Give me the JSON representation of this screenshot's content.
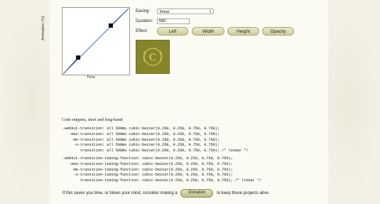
{
  "graph": {
    "y_label": "Animation (%)",
    "x_label": "Time"
  },
  "controls": {
    "easing_label": "Easing:",
    "easing_value": "linear",
    "duration_label": "Duration:",
    "duration_value": "500",
    "effect_label": "Effect:",
    "effects": [
      "Left",
      "Width",
      "Height",
      "Opacity"
    ]
  },
  "preview": {
    "letter": "C"
  },
  "snippets": {
    "title": "Code snippets, short and long-hand:",
    "short": [
      "-webkit-transition: all 500ms cubic-bezier(0.250, 0.250, 0.750, 0.750);",
      "   -moz-transition: all 500ms cubic-bezier(0.250, 0.250, 0.750, 0.750);",
      "    -ms-transition: all 500ms cubic-bezier(0.250, 0.250, 0.750, 0.750);",
      "     -o-transition: all 500ms cubic-bezier(0.250, 0.250, 0.750, 0.750);",
      "        transition: all 500ms cubic-bezier(0.250, 0.250, 0.750, 0.750); /* linear */"
    ],
    "long": [
      "-webkit-transition-timing-function: cubic-bezier(0.250, 0.250, 0.750, 0.750);",
      "   -moz-transition-timing-function: cubic-bezier(0.250, 0.250, 0.750, 0.750);",
      "    -ms-transition-timing-function: cubic-bezier(0.250, 0.250, 0.750, 0.750);",
      "     -o-transition-timing-function: cubic-bezier(0.250, 0.250, 0.750, 0.750);",
      "        transition-timing-function: cubic-bezier(0.250, 0.250, 0.750, 0.750); /* linear */"
    ]
  },
  "footer": {
    "before": "If this saves you time, or blows your mind, consider making a",
    "button": "Donation",
    "after": "to keep these projects alive."
  }
}
